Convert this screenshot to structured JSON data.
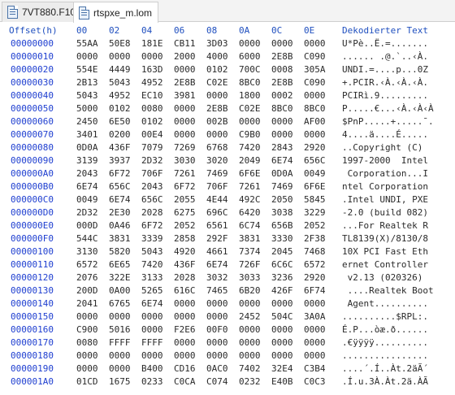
{
  "tabs": [
    {
      "label": "7VT880.F10",
      "active": false
    },
    {
      "label": "rtspxe_m.lom",
      "active": true
    }
  ],
  "header": {
    "offset": "Offset(h)",
    "cols": [
      "00",
      "02",
      "04",
      "06",
      "08",
      "0A",
      "0C",
      "0E"
    ],
    "decoded": "Dekodierter Text"
  },
  "rows": [
    {
      "off": "00000000",
      "h": [
        "55AA",
        "50E8",
        "181E",
        "CB11",
        "3D03",
        "0000",
        "0000",
        "0000"
      ],
      "t": "U*Pè..Ë.=......."
    },
    {
      "off": "00000010",
      "h": [
        "0000",
        "0000",
        "0000",
        "2000",
        "4000",
        "6000",
        "2E8B",
        "C090"
      ],
      "t": "...... .@.`..‹À."
    },
    {
      "off": "00000020",
      "h": [
        "554E",
        "4449",
        "163D",
        "0000",
        "0102",
        "700C",
        "0008",
        "305A"
      ],
      "t": "UNDI.=....p...0Z"
    },
    {
      "off": "00000030",
      "h": [
        "2B13",
        "5043",
        "4952",
        "2E8B",
        "C02E",
        "8BC0",
        "2E8B",
        "C090"
      ],
      "t": "+.PCIR.‹À.‹À.‹À."
    },
    {
      "off": "00000040",
      "h": [
        "5043",
        "4952",
        "EC10",
        "3981",
        "0000",
        "1800",
        "0002",
        "0000"
      ],
      "t": "PCIRì.9........."
    },
    {
      "off": "00000050",
      "h": [
        "5000",
        "0102",
        "0080",
        "0000",
        "2E8B",
        "C02E",
        "8BC0",
        "8BC0"
      ],
      "t": "P.....€...‹À.‹À‹À"
    },
    {
      "off": "00000060",
      "h": [
        "2450",
        "6E50",
        "0102",
        "0000",
        "002B",
        "0000",
        "0000",
        "AF00"
      ],
      "t": "$PnP.....+.....¯."
    },
    {
      "off": "00000070",
      "h": [
        "3401",
        "0200",
        "00E4",
        "0000",
        "0000",
        "C9B0",
        "0000",
        "0000"
      ],
      "t": "4....ä....É....."
    },
    {
      "off": "00000080",
      "h": [
        "0D0A",
        "436F",
        "7079",
        "7269",
        "6768",
        "7420",
        "2843",
        "2920"
      ],
      "t": "..Copyright (C) "
    },
    {
      "off": "00000090",
      "h": [
        "3139",
        "3937",
        "2D32",
        "3030",
        "3020",
        "2049",
        "6E74",
        "656C"
      ],
      "t": "1997-2000  Intel"
    },
    {
      "off": "000000A0",
      "h": [
        "2043",
        "6F72",
        "706F",
        "7261",
        "7469",
        "6F6E",
        "0D0A",
        "0049"
      ],
      "t": " Corporation...I"
    },
    {
      "off": "000000B0",
      "h": [
        "6E74",
        "656C",
        "2043",
        "6F72",
        "706F",
        "7261",
        "7469",
        "6F6E"
      ],
      "t": "ntel Corporation"
    },
    {
      "off": "000000C0",
      "h": [
        "0049",
        "6E74",
        "656C",
        "2055",
        "4E44",
        "492C",
        "2050",
        "5845"
      ],
      "t": ".Intel UNDI, PXE"
    },
    {
      "off": "000000D0",
      "h": [
        "2D32",
        "2E30",
        "2028",
        "6275",
        "696C",
        "6420",
        "3038",
        "3229"
      ],
      "t": "-2.0 (build 082)"
    },
    {
      "off": "000000E0",
      "h": [
        "000D",
        "0A46",
        "6F72",
        "2052",
        "6561",
        "6C74",
        "656B",
        "2052"
      ],
      "t": "...For Realtek R"
    },
    {
      "off": "000000F0",
      "h": [
        "544C",
        "3831",
        "3339",
        "2858",
        "292F",
        "3831",
        "3330",
        "2F38"
      ],
      "t": "TL8139(X)/8130/8"
    },
    {
      "off": "00000100",
      "h": [
        "3130",
        "5820",
        "5043",
        "4920",
        "4661",
        "7374",
        "2045",
        "7468"
      ],
      "t": "10X PCI Fast Eth"
    },
    {
      "off": "00000110",
      "h": [
        "6572",
        "6E65",
        "7420",
        "436F",
        "6E74",
        "726F",
        "6C6C",
        "6572"
      ],
      "t": "ernet Controller"
    },
    {
      "off": "00000120",
      "h": [
        "2076",
        "322E",
        "3133",
        "2028",
        "3032",
        "3033",
        "3236",
        "2920"
      ],
      "t": " v2.13 (020326) "
    },
    {
      "off": "00000130",
      "h": [
        "200D",
        "0A00",
        "5265",
        "616C",
        "7465",
        "6B20",
        "426F",
        "6F74"
      ],
      "t": " ....Realtek Boot"
    },
    {
      "off": "00000140",
      "h": [
        "2041",
        "6765",
        "6E74",
        "0000",
        "0000",
        "0000",
        "0000",
        "0000"
      ],
      "t": " Agent.........."
    },
    {
      "off": "00000150",
      "h": [
        "0000",
        "0000",
        "0000",
        "0000",
        "0000",
        "2452",
        "504C",
        "3A0A"
      ],
      "t": "..........$RPL:."
    },
    {
      "off": "00000160",
      "h": [
        "C900",
        "5016",
        "0000",
        "F2E6",
        "00F0",
        "0000",
        "0000",
        "0000"
      ],
      "t": "É.P...òæ.ð......"
    },
    {
      "off": "00000170",
      "h": [
        "0080",
        "FFFF",
        "FFFF",
        "0000",
        "0000",
        "0000",
        "0000",
        "0000"
      ],
      "t": ".€ÿÿÿÿ.........."
    },
    {
      "off": "00000180",
      "h": [
        "0000",
        "0000",
        "0000",
        "0000",
        "0000",
        "0000",
        "0000",
        "0000"
      ],
      "t": "................"
    },
    {
      "off": "00000190",
      "h": [
        "0000",
        "0000",
        "B400",
        "CD16",
        "0AC0",
        "7402",
        "32E4",
        "C3B4"
      ],
      "t": "....´.Í..Àt.2äÃ´"
    },
    {
      "off": "000001A0",
      "h": [
        "01CD",
        "1675",
        "0233",
        "C0CA",
        "C074",
        "0232",
        "E40B",
        "C0C3"
      ],
      "t": ".Í.u.3À.Àt.2ä.ÀÃ"
    }
  ]
}
